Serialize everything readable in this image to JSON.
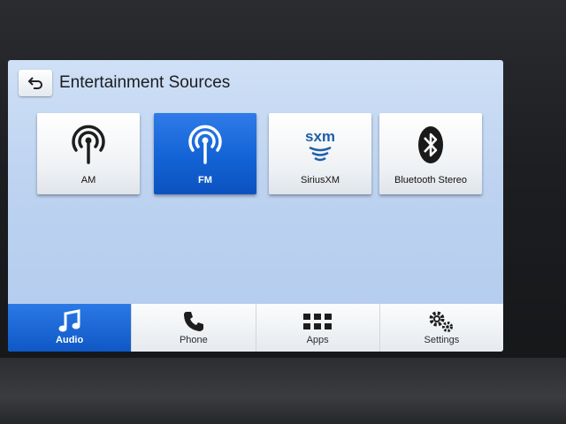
{
  "header": {
    "title": "Entertainment Sources"
  },
  "sources": [
    {
      "label": "AM",
      "icon": "radio-broadcast-icon",
      "selected": false
    },
    {
      "label": "FM",
      "icon": "radio-broadcast-icon",
      "selected": true
    },
    {
      "label": "SiriusXM",
      "icon": "siriusxm-logo",
      "logo_text": "sxm",
      "selected": false
    },
    {
      "label": "Bluetooth Stereo",
      "icon": "bluetooth-icon",
      "selected": false
    }
  ],
  "nav": [
    {
      "label": "Audio",
      "icon": "music-note-icon",
      "selected": true
    },
    {
      "label": "Phone",
      "icon": "phone-icon",
      "selected": false
    },
    {
      "label": "Apps",
      "icon": "apps-grid-icon",
      "selected": false
    },
    {
      "label": "Settings",
      "icon": "gears-icon",
      "selected": false
    }
  ],
  "colors": {
    "accent": "#1363d6",
    "screen_bg": "#c3d7f2"
  }
}
